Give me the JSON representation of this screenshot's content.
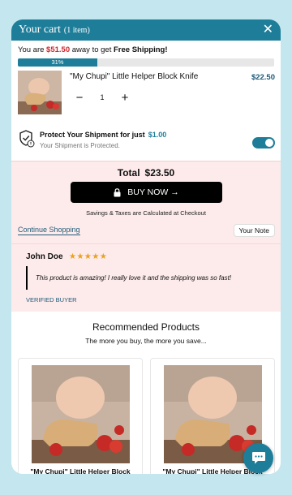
{
  "header": {
    "title": "Your cart",
    "item_count": "(1 item)",
    "close_icon": "close-icon"
  },
  "shipping": {
    "prefix": "You are",
    "amount": "$51.50",
    "middle": "away to get",
    "bold": "Free Shipping!",
    "progress_percent": 31,
    "progress_label": "31%"
  },
  "cart_item": {
    "name": "\"My Chupi\" Little Helper Block Knife",
    "price": "$22.50",
    "quantity": "1",
    "decrease_icon": "minus-icon",
    "increase_icon": "plus-icon"
  },
  "protection": {
    "title": "Protect Your Shipment for just",
    "price": "$1.00",
    "subtitle": "Your Shipment is Protected.",
    "enabled": true,
    "icon": "shield-check-icon"
  },
  "summary": {
    "total_label": "Total",
    "total_value": "$23.50",
    "checkout_label": "BUY NOW →",
    "savings_note": "Savings & Taxes are Calculated at Checkout",
    "continue_label": "Continue Shopping",
    "note_label": "Your Note"
  },
  "review": {
    "name": "John Doe",
    "stars": "★★★★★",
    "rating": 5,
    "quote": "This product is amazing! I really love it and the shipping was so fast!",
    "verified": "VERIFIED BUYER"
  },
  "recommended": {
    "title": "Recommended Products",
    "subtitle": "The more you buy, the more you save...",
    "products": [
      {
        "name": "\"My Chupi\" Little Helper Block"
      },
      {
        "name": "\"My Chupi\" Little Helper Block"
      }
    ]
  },
  "chat": {
    "icon": "chat-icon"
  },
  "colors": {
    "brand": "#1e7e99",
    "accent_red": "#d3262a",
    "summary_bg": "#fdeaea",
    "star": "#e8a21c",
    "page_bg": "#c4e6ee"
  }
}
